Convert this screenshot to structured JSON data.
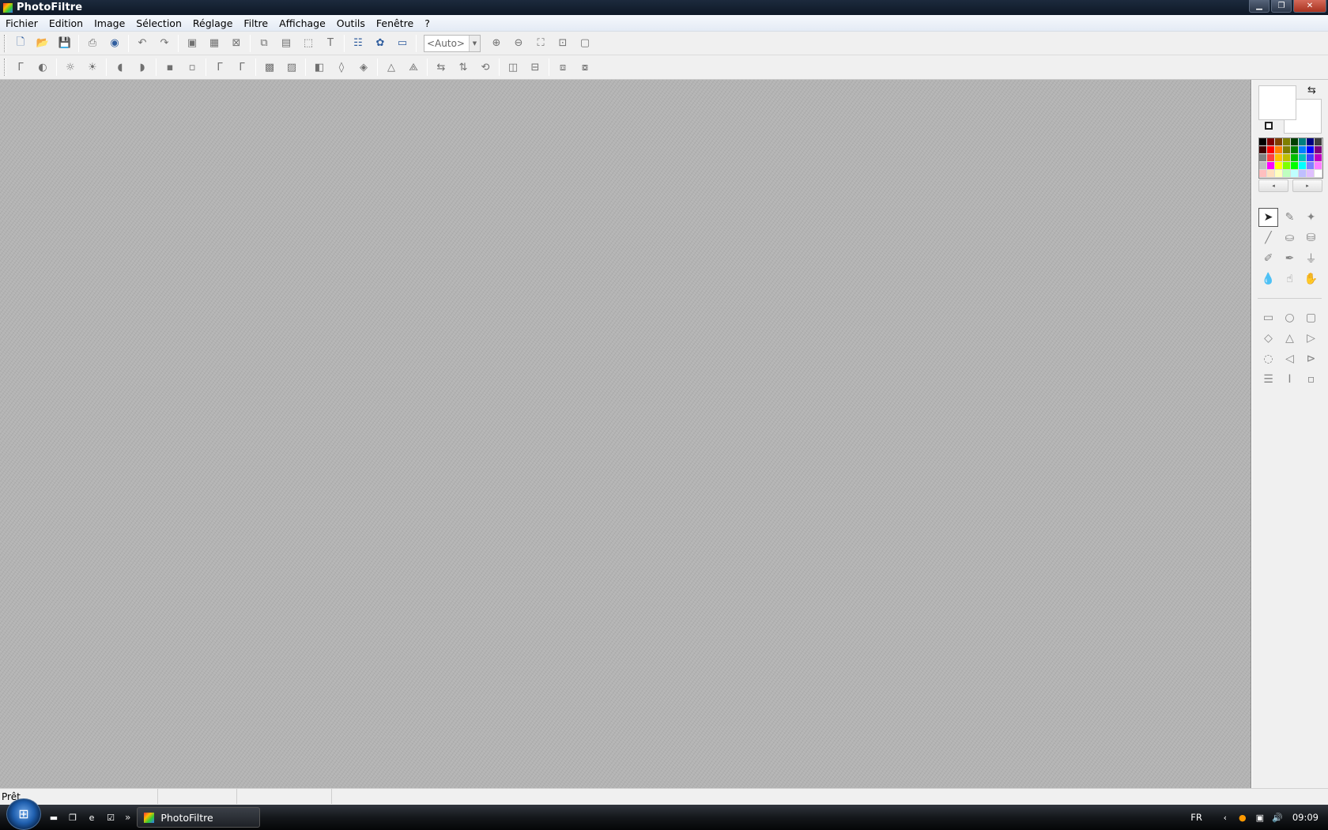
{
  "window": {
    "title": "PhotoFiltre"
  },
  "menu": [
    "Fichier",
    "Edition",
    "Image",
    "Sélection",
    "Réglage",
    "Filtre",
    "Affichage",
    "Outils",
    "Fenêtre",
    "?"
  ],
  "toolbar1": {
    "zoom_value": "<Auto>",
    "icons": [
      "new-file-icon",
      "open-folder-icon",
      "save-icon",
      "print-icon",
      "scan-icon",
      "undo-icon",
      "redo-icon",
      "image-size-icon",
      "canvas-size-icon",
      "crop-icon",
      "copy-icon",
      "paste-icon",
      "select-all-icon",
      "text-icon",
      "explorer-icon",
      "plugin-icon",
      "browser-icon",
      "zoom-in-icon",
      "zoom-out-icon",
      "fit-window-icon",
      "actual-size-icon",
      "fullscreen-icon"
    ]
  },
  "toolbar2": {
    "icons": [
      "auto-levels-icon",
      "auto-contrast-icon",
      "brightness-minus-icon",
      "brightness-plus-icon",
      "contrast-minus-icon",
      "contrast-plus-icon",
      "saturation-minus-icon",
      "saturation-plus-icon",
      "gamma-minus-icon",
      "gamma-plus-icon",
      "grayscale-icon",
      "sepia-icon",
      "invert-icon",
      "blur-icon",
      "soften-icon",
      "sharpen-icon",
      "sharpen-more-icon",
      "flip-horizontal-icon",
      "flip-vertical-icon",
      "rotate-icon",
      "rotate-left-icon",
      "rotate-right-icon",
      "transparency-icon",
      "layer-icon"
    ]
  },
  "palette": {
    "swatches": [
      "#000000",
      "#7f0000",
      "#7f3f00",
      "#7f7f00",
      "#003f00",
      "#007f7f",
      "#00007f",
      "#3f3f3f",
      "#3f0000",
      "#ff0000",
      "#ff7f00",
      "#7f7f00",
      "#007f00",
      "#007fff",
      "#0000ff",
      "#7f007f",
      "#7f7f7f",
      "#ff3f3f",
      "#ffbf00",
      "#bfbf00",
      "#00bf00",
      "#00bfbf",
      "#3f3fff",
      "#bf00bf",
      "#bfbfbf",
      "#ff00ff",
      "#ffff00",
      "#7fff00",
      "#00ff00",
      "#00ffff",
      "#7f7fff",
      "#ff7fff",
      "#ffbfbf",
      "#ffdfbf",
      "#ffffbf",
      "#bfffbf",
      "#bfffff",
      "#bfbfff",
      "#dfbfff",
      "#ffffff"
    ],
    "prev_label": "◂",
    "next_label": "▸"
  },
  "tools": [
    "pointer-icon",
    "eyedropper-icon",
    "magic-wand-icon",
    "line-icon",
    "fill-bucket-icon",
    "spray-icon",
    "brush-icon",
    "advanced-brush-icon",
    "clone-stamp-icon",
    "drop-blur-icon",
    "smudge-icon",
    "hand-icon",
    "rectangle-icon",
    "ellipse-icon",
    "rounded-rect-icon",
    "diamond-icon",
    "triangle-icon",
    "arrow-shape-icon",
    "lasso-icon",
    "polygon-icon",
    "open-selection-icon",
    "hline-icon",
    "vline-icon",
    "ratio-icon"
  ],
  "status": {
    "text": "Prêt"
  },
  "taskbar": {
    "task_label": "PhotoFiltre",
    "lang": "FR",
    "clock": "09:09"
  }
}
